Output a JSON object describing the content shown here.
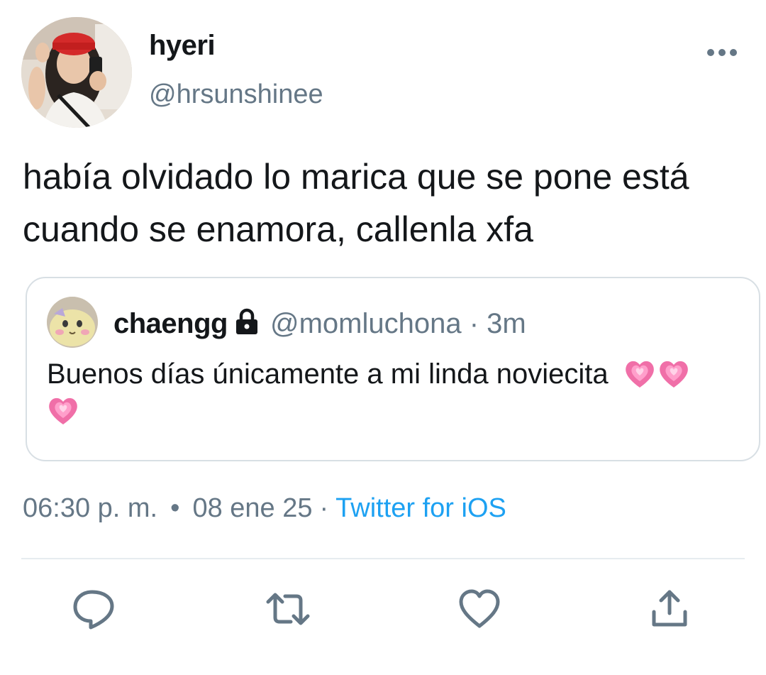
{
  "author": {
    "display_name": "hyeri",
    "handle": "@hrsunshinee"
  },
  "tweet": {
    "text": "había olvidado lo marica que se pone está cuando se enamora, callenla xfa",
    "time": "06:30 p. m.",
    "date": "08 ene 25",
    "source": "Twitter for iOS"
  },
  "quoted_tweet": {
    "display_name": "chaengg",
    "handle": "@momluchona",
    "relative_time": "3m",
    "text": "Buenos días únicamente a mi linda noviecita",
    "trailing_emojis": [
      "growing-heart-icon",
      "growing-heart-icon",
      "growing-heart-icon"
    ],
    "protected": true
  },
  "actions": [
    "reply-icon",
    "retweet-icon",
    "like-icon",
    "share-icon"
  ],
  "colors": {
    "text": "#14171a",
    "secondary": "#657786",
    "link": "#1da1f2",
    "border": "#d8dfe4",
    "heart": "#f06fa8"
  }
}
